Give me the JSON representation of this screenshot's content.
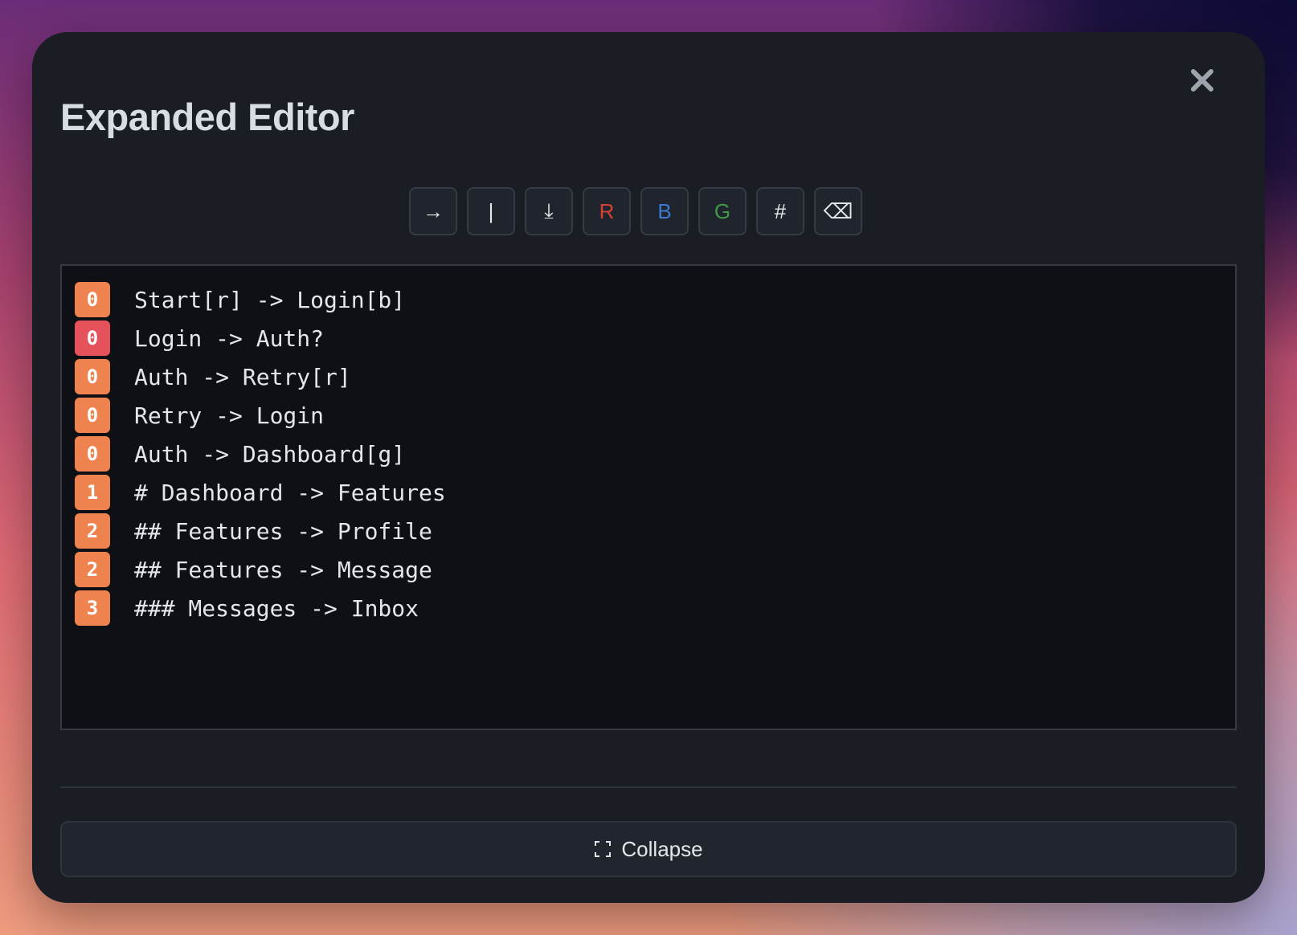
{
  "modal": {
    "title": "Expanded Editor"
  },
  "toolbar": {
    "buttons": [
      {
        "label": "→",
        "name": "arrow-button",
        "color": "#e6e8ec"
      },
      {
        "label": "|",
        "name": "pipe-button",
        "color": "#e6e8ec"
      },
      {
        "label": "⤓",
        "name": "insert-down-button",
        "color": "#e6e8ec"
      },
      {
        "label": "R",
        "name": "red-tag-button",
        "color": "#d64236"
      },
      {
        "label": "B",
        "name": "blue-tag-button",
        "color": "#3c7bd3"
      },
      {
        "label": "G",
        "name": "green-tag-button",
        "color": "#3f9a48"
      },
      {
        "label": "#",
        "name": "heading-button",
        "color": "#e6e8ec"
      },
      {
        "label": "⌫",
        "name": "backspace-button",
        "color": "#e6e8ec"
      }
    ]
  },
  "editor": {
    "lines": [
      {
        "level": "0",
        "text": "Start[r] -> Login[b]",
        "error": false
      },
      {
        "level": "0",
        "text": "Login -> Auth?",
        "error": true
      },
      {
        "level": "0",
        "text": "Auth -> Retry[r]",
        "error": false
      },
      {
        "level": "0",
        "text": "Retry -> Login",
        "error": false
      },
      {
        "level": "0",
        "text": "Auth -> Dashboard[g]",
        "error": false
      },
      {
        "level": "1",
        "text": "# Dashboard -> Features",
        "error": false
      },
      {
        "level": "2",
        "text": "## Features -> Profile",
        "error": false
      },
      {
        "level": "2",
        "text": "## Features -> Message",
        "error": false
      },
      {
        "level": "3",
        "text": "### Messages -> Inbox",
        "error": false
      }
    ]
  },
  "footer": {
    "collapse_label": "Collapse",
    "collapse_icon": "collapse-icon"
  },
  "close_icon": "close-icon",
  "colors": {
    "badge": "#ee8350",
    "badge_error": "#e5525c",
    "panel": "#1a1d24",
    "editor_bg": "#0e1015"
  }
}
